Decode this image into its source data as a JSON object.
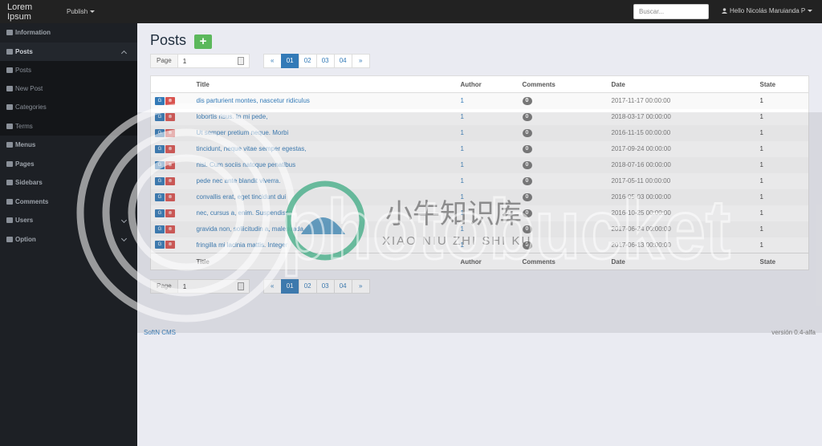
{
  "navbar": {
    "brand": "Lorem Ipsum",
    "publish_label": "Publish",
    "search_placeholder": "Buscar...",
    "user_label": "Hello Nicolás Maruianda P"
  },
  "sidebar": {
    "items": [
      {
        "label": "Information",
        "icon": "dashboard-icon"
      },
      {
        "label": "Posts",
        "icon": "bullhorn-icon",
        "expanded": true,
        "children": [
          {
            "label": "Posts",
            "icon": "bullhorn-icon"
          },
          {
            "label": "New Post",
            "icon": "pencil-icon"
          },
          {
            "label": "Categories",
            "icon": "bookmark-icon"
          },
          {
            "label": "Terms",
            "icon": "tags-icon"
          }
        ]
      },
      {
        "label": "Menus",
        "icon": "list-icon"
      },
      {
        "label": "Pages",
        "icon": "file-icon"
      },
      {
        "label": "Sidebars",
        "icon": "columns-icon"
      },
      {
        "label": "Comments",
        "icon": "comment-icon"
      },
      {
        "label": "Users",
        "icon": "user-icon",
        "collapsible": true
      },
      {
        "label": "Option",
        "icon": "gear-icon",
        "collapsible": true
      }
    ]
  },
  "main": {
    "title": "Posts",
    "add_label": "+",
    "pager": {
      "label": "Page",
      "value": "1",
      "prev": "«",
      "next": "»",
      "pages": [
        "01",
        "02",
        "03",
        "04"
      ],
      "active": "01"
    },
    "table": {
      "columns": [
        "",
        "Title",
        "Author",
        "Comments",
        "Date",
        "State"
      ],
      "rows": [
        {
          "title": "dis parturient montes, nascetur ridiculus",
          "author": "1",
          "comments": "0",
          "date": "2017-11-17 00:00:00",
          "state": "1"
        },
        {
          "title": "lobortis risus. In mi pede,",
          "author": "1",
          "comments": "0",
          "date": "2018-03-17 00:00:00",
          "state": "1"
        },
        {
          "title": "Ut semper pretium neque. Morbi",
          "author": "1",
          "comments": "0",
          "date": "2016-11-15 00:00:00",
          "state": "1"
        },
        {
          "title": "tincidunt, neque vitae semper egestas,",
          "author": "1",
          "comments": "0",
          "date": "2017-09-24 00:00:00",
          "state": "1"
        },
        {
          "title": "nisi. Cum sociis natoque penatibus",
          "author": "1",
          "comments": "0",
          "date": "2018-07-16 00:00:00",
          "state": "1"
        },
        {
          "title": "pede nec ante blandit viverra.",
          "author": "1",
          "comments": "0",
          "date": "2017-05-11 00:00:00",
          "state": "1"
        },
        {
          "title": "convallis erat, eget tincidunt dui",
          "author": "1",
          "comments": "0",
          "date": "2016-05-03 00:00:00",
          "state": "1"
        },
        {
          "title": "nec, cursus a, enim. Suspendisse",
          "author": "1",
          "comments": "0",
          "date": "2016-10-25 00:00:00",
          "state": "1"
        },
        {
          "title": "gravida non, sollicitudin a, malesuada",
          "author": "1",
          "comments": "0",
          "date": "2017-06-24 00:00:00",
          "state": "1"
        },
        {
          "title": "fringilla mi lacinia mattis. Integer",
          "author": "1",
          "comments": "0",
          "date": "2017-06-13 00:00:00",
          "state": "1"
        }
      ],
      "edit_label": "G",
      "delete_label": "⊗"
    }
  },
  "footer": {
    "left": "SoftN CMS",
    "right": "versión 0.4-alfa"
  },
  "watermark": {
    "text_cn": "小牛知识库",
    "text_pinyin": "XIAO NIU ZHI SHI KU",
    "text_brand": "photobucket"
  },
  "colors": {
    "navbar_bg": "#222222",
    "sidebar_bg": "#1d2025",
    "accent": "#337ab7",
    "add_button": "#5cb85c",
    "delete_button": "#d9534f"
  }
}
